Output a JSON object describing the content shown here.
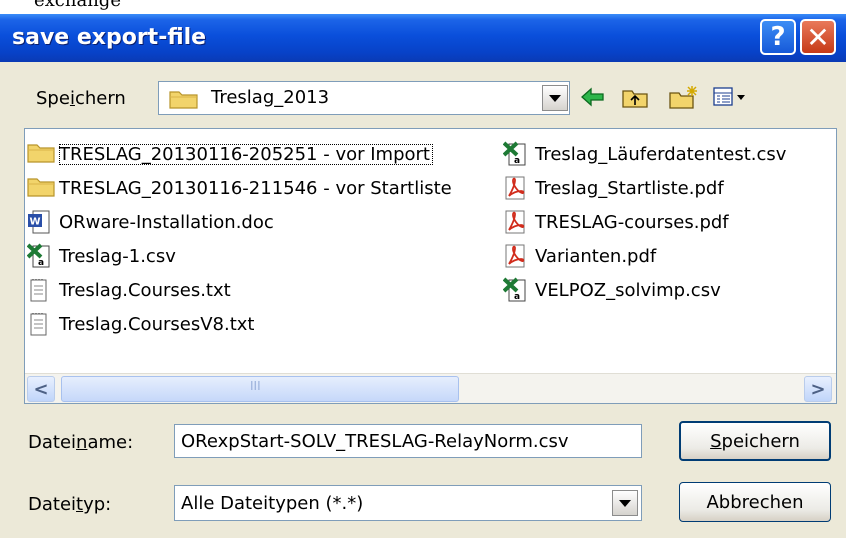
{
  "top_fragment": "exchange",
  "window": {
    "title": "save export-file",
    "help_label": "?",
    "close_label": "✕"
  },
  "toolbar": {
    "save_in_prefix": "Spe",
    "save_in_underline": "i",
    "save_in_suffix": "chern",
    "folder_name": "Treslag_2013",
    "icons": [
      "back-arrow-icon",
      "up-folder-icon",
      "new-folder-icon",
      "view-menu-icon"
    ]
  },
  "files": [
    {
      "name": "TRESLAG_20130116-205251 - vor Import",
      "type": "folder",
      "focused": true
    },
    {
      "name": "TRESLAG_20130116-211546 - vor Startliste",
      "type": "folder"
    },
    {
      "name": "ORware-Installation.doc",
      "type": "word"
    },
    {
      "name": "Treslag-1.csv",
      "type": "excel"
    },
    {
      "name": "Treslag.Courses.txt",
      "type": "text"
    },
    {
      "name": "Treslag.CoursesV8.txt",
      "type": "text"
    },
    {
      "name": "Treslag_Läuferdatentest.csv",
      "type": "excel"
    },
    {
      "name": "Treslag_Startliste.pdf",
      "type": "pdf"
    },
    {
      "name": "TRESLAG-courses.pdf",
      "type": "pdf"
    },
    {
      "name": "Varianten.pdf",
      "type": "pdf"
    },
    {
      "name": "VELPOZ_solvimp.csv",
      "type": "excel"
    }
  ],
  "scrollbar": {
    "left_arrow": "<",
    "right_arrow": ">",
    "thumb_grip": "III"
  },
  "filename": {
    "label_prefix": "Datei",
    "label_underline": "n",
    "label_suffix": "ame:",
    "value": "ORexpStart-SOLV_TRESLAG-RelayNorm.csv"
  },
  "filetype": {
    "label_prefix": "Datei",
    "label_underline": "t",
    "label_suffix": "yp:",
    "value": "Alle Dateitypen (*.*)"
  },
  "buttons": {
    "save_underline": "S",
    "save_rest": "peichern",
    "cancel": "Abbrechen"
  },
  "colors": {
    "titlebar": "#0A4FDB",
    "dialog_bg": "#ECE9D8",
    "folder": "#F2D46B",
    "excel": "#1E7A35",
    "pdf": "#D12C1C",
    "word": "#2A4FA8"
  }
}
